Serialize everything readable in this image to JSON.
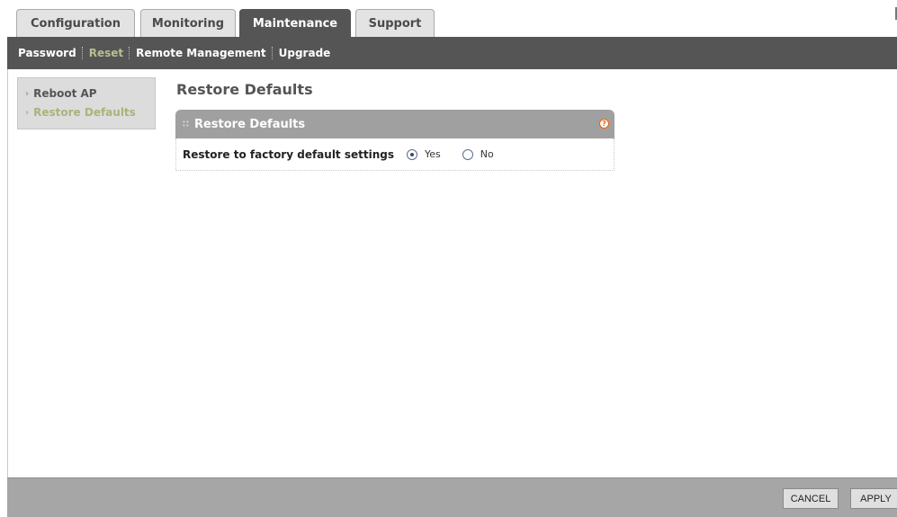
{
  "tabs": [
    {
      "label": "Configuration",
      "active": false
    },
    {
      "label": "Monitoring",
      "active": false
    },
    {
      "label": "Maintenance",
      "active": true
    },
    {
      "label": "Support",
      "active": false
    }
  ],
  "subnav": [
    {
      "label": "Password",
      "active": false
    },
    {
      "label": "Reset",
      "active": true
    },
    {
      "label": "Remote Management",
      "active": false
    },
    {
      "label": "Upgrade",
      "active": false
    }
  ],
  "sidemenu": [
    {
      "label": "Reboot AP",
      "active": false
    },
    {
      "label": "Restore Defaults",
      "active": true
    }
  ],
  "page": {
    "title": "Restore Defaults",
    "panel_title": "Restore Defaults",
    "help_icon": "help-icon",
    "field_label": "Restore to factory default settings",
    "options": [
      {
        "label": "Yes",
        "selected": true
      },
      {
        "label": "No",
        "selected": false
      }
    ]
  },
  "footer": {
    "cancel_label": "CANCEL",
    "apply_label": "APPLY"
  },
  "colors": {
    "nav_dark": "#555555",
    "active_subnav": "#b6bf8f",
    "help_accent": "#ff5a00",
    "footer_bg": "#a6a6a6"
  }
}
